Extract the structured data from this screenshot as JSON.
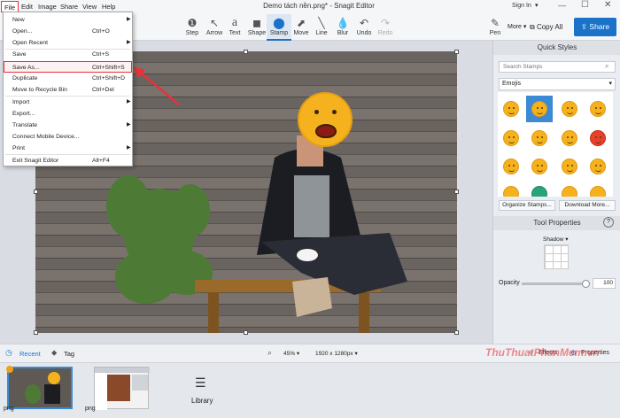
{
  "window": {
    "title": "Demo tách nền.png* - Snagit Editor",
    "sign_in": "Sign In"
  },
  "menu": [
    "File",
    "Edit",
    "Image",
    "Share",
    "View",
    "Help"
  ],
  "file_menu": [
    {
      "label": "New",
      "shortcut": "",
      "submenu": true
    },
    {
      "label": "Open...",
      "shortcut": "Ctrl+O",
      "submenu": false
    },
    {
      "label": "Open Recent",
      "shortcut": "",
      "submenu": true
    },
    {
      "label": "Save",
      "shortcut": "Ctrl+S",
      "submenu": false
    },
    {
      "label": "Save As...",
      "shortcut": "Ctrl+Shift+S",
      "submenu": false
    },
    {
      "label": "Duplicate",
      "shortcut": "Ctrl+Shift+D",
      "submenu": false
    },
    {
      "label": "Move to Recycle Bin",
      "shortcut": "Ctrl+Del",
      "submenu": false
    },
    {
      "label": "Import",
      "shortcut": "",
      "submenu": true
    },
    {
      "label": "Export...",
      "shortcut": "",
      "submenu": false
    },
    {
      "label": "Translate",
      "shortcut": "",
      "submenu": true
    },
    {
      "label": "Connect Mobile Device...",
      "shortcut": "",
      "submenu": false
    },
    {
      "label": "Print",
      "shortcut": "",
      "submenu": true
    },
    {
      "label": "Exit Snagit Editor",
      "shortcut": "Alt+F4",
      "submenu": false
    }
  ],
  "tools": [
    {
      "label": "Step",
      "icon": "step-icon"
    },
    {
      "label": "Arrow",
      "icon": "arrow-icon"
    },
    {
      "label": "Text",
      "icon": "text-icon"
    },
    {
      "label": "Shape",
      "icon": "shape-icon"
    },
    {
      "label": "Stamp",
      "icon": "stamp-icon",
      "active": true
    },
    {
      "label": "Move",
      "icon": "move-icon"
    },
    {
      "label": "Line",
      "icon": "line-icon"
    },
    {
      "label": "Blur",
      "icon": "blur-icon"
    },
    {
      "label": "Undo",
      "icon": "undo-icon"
    },
    {
      "label": "Redo",
      "icon": "redo-icon",
      "disabled": true
    }
  ],
  "toolbar_right": {
    "pen": "Pen",
    "more": "More",
    "copy_all": "Copy All",
    "share": "Share"
  },
  "quick_styles": {
    "header": "Quick Styles",
    "search_placeholder": "Search Stamps",
    "category": "Emojis",
    "organize": "Organize Stamps...",
    "download": "Download More..."
  },
  "tool_properties": {
    "header": "Tool Properties",
    "shadow": "Shadow",
    "opacity_label": "Opacity",
    "opacity_value": "100"
  },
  "bottom": {
    "recent": "Recent",
    "tag": "Tag",
    "zoom": "45%",
    "dimensions": "1920 x 1280px",
    "effects": "Effects",
    "properties": "Properties"
  },
  "tray": {
    "items": [
      "png",
      "png"
    ],
    "library": "Library"
  },
  "watermark": "ThuThuatPhanMem.vn",
  "colors": {
    "accent": "#1a73c9",
    "highlight": "#e8313a",
    "emoji": "#f5b21e"
  }
}
